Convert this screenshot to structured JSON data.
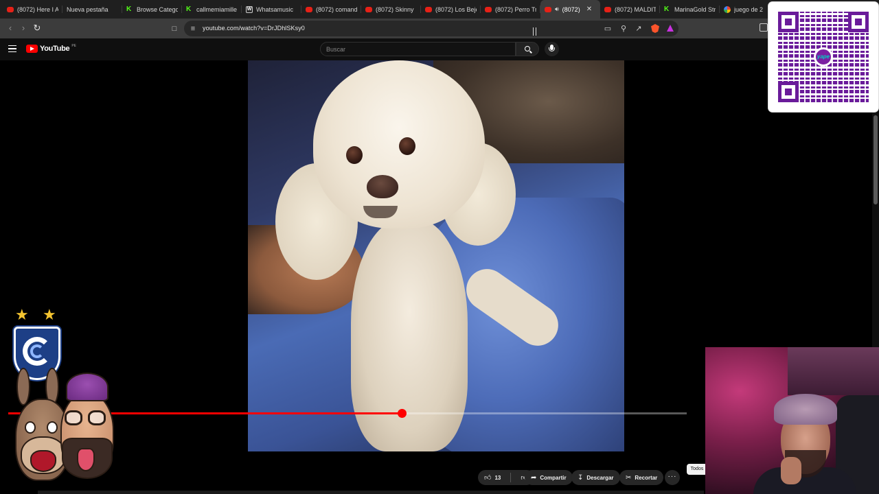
{
  "browser": {
    "tabs": [
      {
        "label": "(8072) Here I A",
        "icon": "youtube-icon"
      },
      {
        "label": "Nueva pestaña",
        "icon": "none"
      },
      {
        "label": "Browse Catego",
        "icon": "kick-icon"
      },
      {
        "label": "callmemiamille",
        "icon": "kick-icon"
      },
      {
        "label": "Whatsamusic",
        "icon": "whatsamusic-icon"
      },
      {
        "label": "(8072) comand",
        "icon": "youtube-icon"
      },
      {
        "label": "(8072) Skinny",
        "icon": "youtube-icon"
      },
      {
        "label": "(8072) Los Beje",
        "icon": "youtube-icon"
      },
      {
        "label": "(8072) Perro Tr",
        "icon": "youtube-icon"
      },
      {
        "label": "(8072)",
        "icon": "youtube-icon",
        "active": true,
        "audio": true
      },
      {
        "label": "(8072) MALDIT",
        "icon": "youtube-icon"
      },
      {
        "label": "MarinaGold Str",
        "icon": "kick-icon"
      },
      {
        "label": "juego de 2",
        "icon": "google-icon"
      }
    ],
    "url": "youtube.com/watch?v=DrJDhlSKsy0"
  },
  "youtube": {
    "logo_text": "YouTube",
    "country_code": "PE",
    "search_placeholder": "Buscar",
    "actions": {
      "like_count": "13",
      "share_label": "Compartir",
      "download_label": "Descargar",
      "clip_label": "Recortar"
    },
    "chip_label": "Todos",
    "progress_fraction": 0.58
  },
  "overlay": {
    "qr_brand": "yape",
    "stars": 2
  },
  "colors": {
    "youtube_red": "#ff0000",
    "kick_green": "#53fc18",
    "yape_purple": "#6a1b9a",
    "brave_orange": "#fb542b"
  }
}
